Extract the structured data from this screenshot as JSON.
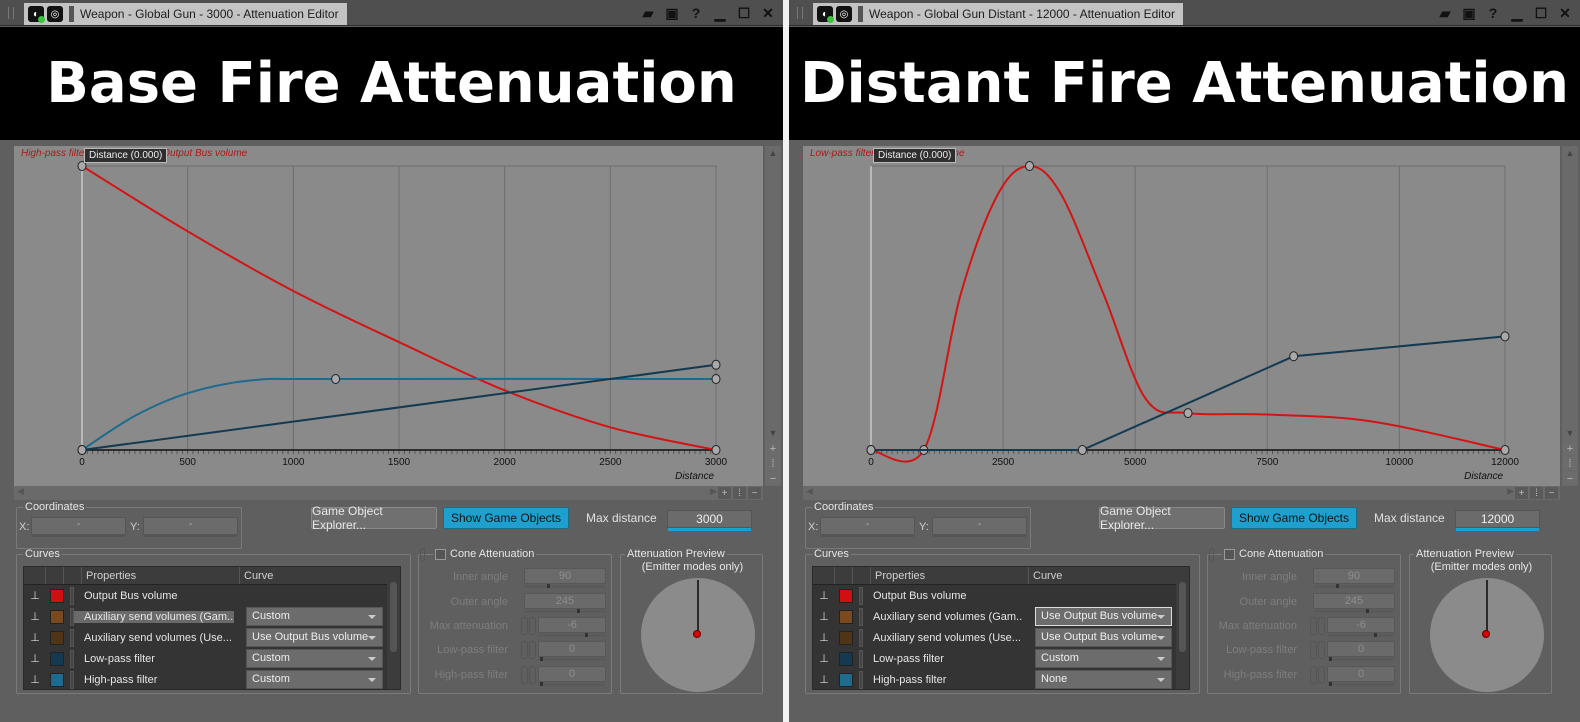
{
  "panels": [
    {
      "window_title": "Weapon - Global Gun - 3000 - Attenuation Editor",
      "banner": "Base Fire Attenuation",
      "graph": {
        "legend_text": "High-pass filter, Low-pass filter, Output Bus volume",
        "tooltip": "Distance (0.000)",
        "x_label": "Distance",
        "max_distance": 3000,
        "x_ticks": [
          "0",
          "500",
          "1000",
          "1500",
          "2000",
          "2500",
          "3000"
        ]
      },
      "coordinates": {
        "title": "Coordinates",
        "x_label": "X:",
        "y_label": "Y:",
        "x_value": "-",
        "y_value": "-"
      },
      "buttons": {
        "explorer": "Game Object Explorer...",
        "show": "Show Game Objects"
      },
      "max_distance": {
        "label": "Max distance",
        "value": "3000"
      },
      "curves": {
        "title": "Curves",
        "headers": {
          "properties": "Properties",
          "curve": "Curve"
        },
        "rows": [
          {
            "name": "Output Bus volume",
            "color": "#d01010",
            "curve": ""
          },
          {
            "name": "Auxiliary send volumes (Gam...",
            "color": "#7a4a1e",
            "curve": "Custom"
          },
          {
            "name": "Auxiliary send volumes (Use...",
            "color": "#4f3416",
            "curve": "Use Output Bus volume"
          },
          {
            "name": "Low-pass filter",
            "color": "#143a52",
            "curve": "Custom"
          },
          {
            "name": "High-pass filter",
            "color": "#1f6a8f",
            "curve": "Custom"
          }
        ]
      },
      "cone": {
        "title": "Cone Attenuation",
        "inner_angle": {
          "label": "Inner angle",
          "value": "90"
        },
        "outer_angle": {
          "label": "Outer angle",
          "value": "245"
        },
        "max_attenuation": {
          "label": "Max attenuation",
          "value": "-6"
        },
        "low_pass": {
          "label": "Low-pass filter",
          "value": "0"
        },
        "high_pass": {
          "label": "High-pass filter",
          "value": "0"
        }
      },
      "preview": {
        "title": "Attenuation Preview",
        "subtitle": "(Emitter modes only)"
      }
    },
    {
      "window_title": "Weapon - Global Gun Distant - 12000 - Attenuation Editor",
      "banner": "Distant Fire Attenuation",
      "graph": {
        "legend_text": "Low-pass filter, Output Bus volume",
        "tooltip": "Distance (0.000)",
        "x_label": "Distance",
        "max_distance": 12000,
        "x_ticks": [
          "0",
          "2500",
          "5000",
          "7500",
          "10000",
          "12000"
        ]
      },
      "coordinates": {
        "title": "Coordinates",
        "x_label": "X:",
        "y_label": "Y:",
        "x_value": "-",
        "y_value": "-"
      },
      "buttons": {
        "explorer": "Game Object Explorer...",
        "show": "Show Game Objects"
      },
      "max_distance": {
        "label": "Max distance",
        "value": "12000"
      },
      "curves": {
        "title": "Curves",
        "headers": {
          "properties": "Properties",
          "curve": "Curve"
        },
        "rows": [
          {
            "name": "Output Bus volume",
            "color": "#d01010",
            "curve": ""
          },
          {
            "name": "Auxiliary send volumes (Gam...",
            "color": "#7a4a1e",
            "curve": "Use Output Bus volume"
          },
          {
            "name": "Auxiliary send volumes (Use...",
            "color": "#4f3416",
            "curve": "Use Output Bus volume"
          },
          {
            "name": "Low-pass filter",
            "color": "#143a52",
            "curve": "Custom"
          },
          {
            "name": "High-pass filter",
            "color": "#1f6a8f",
            "curve": "None"
          }
        ]
      },
      "cone": {
        "title": "Cone Attenuation",
        "inner_angle": {
          "label": "Inner angle",
          "value": "90"
        },
        "outer_angle": {
          "label": "Outer angle",
          "value": "245"
        },
        "max_attenuation": {
          "label": "Max attenuation",
          "value": "-6"
        },
        "low_pass": {
          "label": "Low-pass filter",
          "value": "0"
        },
        "high_pass": {
          "label": "High-pass filter",
          "value": "0"
        }
      },
      "preview": {
        "title": "Attenuation Preview",
        "subtitle": "(Emitter modes only)"
      }
    }
  ],
  "icons": {
    "open": "folder-open-icon",
    "save": "save-icon",
    "help": "help-icon",
    "minimize": "minimize-icon",
    "maximize": "maximize-icon",
    "close": "close-icon"
  },
  "chart_data": [
    {
      "type": "line",
      "title": "Base Fire Attenuation",
      "xlabel": "Distance",
      "xlim": [
        0,
        3000
      ],
      "ylim": [
        0,
        1
      ],
      "x_ticks": [
        0,
        500,
        1000,
        1500,
        2000,
        2500,
        3000
      ],
      "series": [
        {
          "name": "Output Bus volume",
          "color": "#d41414",
          "shape": "curve",
          "points": [
            [
              0,
              1.0
            ],
            [
              500,
              0.77
            ],
            [
              1000,
              0.56
            ],
            [
              1500,
              0.38
            ],
            [
              2000,
              0.21
            ],
            [
              2500,
              0.08
            ],
            [
              3000,
              0.0
            ]
          ]
        },
        {
          "name": "High-pass filter",
          "color": "#1f6a8f",
          "shape": "curve",
          "points": [
            [
              0,
              0.0
            ],
            [
              250,
              0.12
            ],
            [
              500,
              0.2
            ],
            [
              800,
              0.245
            ],
            [
              1200,
              0.25
            ],
            [
              3000,
              0.25
            ]
          ],
          "control_points": [
            [
              0,
              0.0
            ],
            [
              1200,
              0.25
            ],
            [
              3000,
              0.25
            ]
          ]
        },
        {
          "name": "Low-pass filter",
          "color": "#143a52",
          "shape": "linear",
          "points": [
            [
              0,
              0.0
            ],
            [
              3000,
              0.3
            ]
          ],
          "control_points": [
            [
              0,
              0.0
            ],
            [
              3000,
              0.3
            ]
          ]
        }
      ]
    },
    {
      "type": "line",
      "title": "Distant Fire Attenuation",
      "xlabel": "Distance",
      "xlim": [
        0,
        12000
      ],
      "ylim": [
        0,
        1
      ],
      "x_ticks": [
        0,
        2500,
        5000,
        7500,
        10000,
        12000
      ],
      "series": [
        {
          "name": "Output Bus volume",
          "color": "#d41414",
          "shape": "curve",
          "points": [
            [
              0,
              0.0
            ],
            [
              1000,
              0.0
            ],
            [
              1700,
              0.55
            ],
            [
              2400,
              0.9
            ],
            [
              3000,
              1.0
            ],
            [
              3600,
              0.9
            ],
            [
              4400,
              0.55
            ],
            [
              5200,
              0.18
            ],
            [
              6000,
              0.13
            ],
            [
              7500,
              0.125
            ],
            [
              9500,
              0.1
            ],
            [
              12000,
              0.0
            ]
          ],
          "control_points": [
            [
              0,
              0.0
            ],
            [
              1000,
              0.0
            ],
            [
              3000,
              1.0
            ],
            [
              6000,
              0.13
            ],
            [
              12000,
              0.0
            ]
          ]
        },
        {
          "name": "Low-pass filter",
          "color": "#143a52",
          "shape": "linear",
          "points": [
            [
              0,
              0.0
            ],
            [
              4000,
              0.0
            ],
            [
              8000,
              0.33
            ],
            [
              12000,
              0.4
            ]
          ],
          "control_points": [
            [
              0,
              0.0
            ],
            [
              4000,
              0.0
            ],
            [
              8000,
              0.33
            ],
            [
              12000,
              0.4
            ]
          ]
        }
      ]
    }
  ]
}
